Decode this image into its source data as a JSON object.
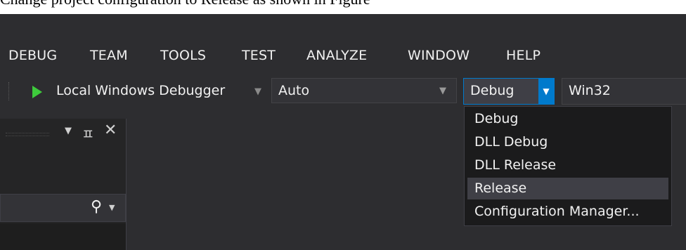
{
  "caption": "Change project configuration to Release as shown in Figure",
  "menu": [
    "DEBUG",
    "TEAM",
    "TOOLS",
    "TEST",
    "ANALYZE",
    "WINDOW",
    "HELP"
  ],
  "toolbar": {
    "debugger_label": "Local Windows Debugger",
    "mode_value": "Auto",
    "config_value": "Debug",
    "platform_value": "Win32"
  },
  "dropdown": {
    "items": [
      "Debug",
      "DLL Debug",
      "DLL Release",
      "Release",
      "Configuration Manager..."
    ],
    "selected": "Release"
  },
  "icons": {
    "play": "play-icon",
    "dropdown_arrow": "chevron-down-icon",
    "pin": "pin-icon",
    "close": "close-icon",
    "search": "search-icon"
  },
  "colors": {
    "background": "#2d2d30",
    "accent": "#007acc",
    "play": "#3ecb3c",
    "selected_item": "#3f3f46"
  }
}
